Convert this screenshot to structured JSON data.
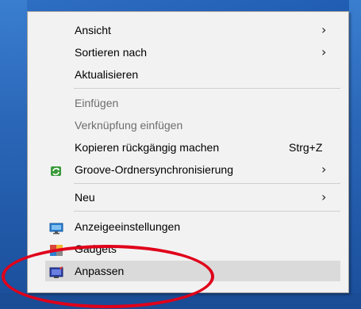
{
  "context_menu": {
    "items": [
      {
        "label": "Ansicht",
        "submenu": true
      },
      {
        "label": "Sortieren nach",
        "submenu": true
      },
      {
        "label": "Aktualisieren"
      },
      {
        "label": "Einfügen",
        "disabled": true
      },
      {
        "label": "Verknüpfung einfügen",
        "disabled": true
      },
      {
        "label": "Kopieren rückgängig machen",
        "shortcut": "Strg+Z"
      },
      {
        "label": "Groove-Ordnersynchronisierung",
        "submenu": true,
        "icon": "groove-sync-icon"
      },
      {
        "label": "Neu",
        "submenu": true
      },
      {
        "label": "Anzeigeeinstellungen",
        "icon": "display-settings-icon"
      },
      {
        "label": "Gadgets",
        "icon": "gadgets-icon"
      },
      {
        "label": "Anpassen",
        "icon": "personalize-icon",
        "highlighted": true
      }
    ],
    "submenu_arrow": "›"
  },
  "annotation": {
    "shape": "red-ellipse",
    "color": "#e0001a"
  },
  "colors": {
    "menu_bg": "#f2f2f2",
    "hover_bg": "#dadada",
    "disabled_text": "#6d6d6d",
    "desktop": "#1e5bb0"
  }
}
